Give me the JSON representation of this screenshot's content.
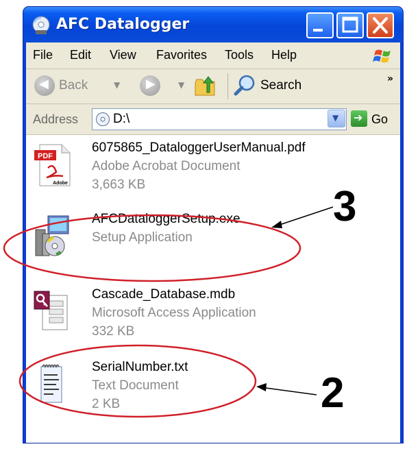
{
  "window": {
    "title": "AFC Datalogger",
    "title_icon": "cd-drive-icon",
    "controls": [
      "minimize",
      "maximize",
      "close"
    ]
  },
  "menubar": {
    "items": [
      "File",
      "Edit",
      "View",
      "Favorites",
      "Tools",
      "Help"
    ]
  },
  "toolbar": {
    "back_label": "Back",
    "search_label": "Search",
    "overflow": "»"
  },
  "address": {
    "label": "Address",
    "value": "D:\\",
    "go_label": "Go"
  },
  "files": [
    {
      "name": "6075865_DataloggerUserManual.pdf",
      "type": "Adobe Acrobat Document",
      "size": "3,663 KB",
      "icon": "pdf-icon"
    },
    {
      "name": "AFCDataloggerSetup.exe",
      "type": "Setup Application",
      "size": "",
      "icon": "setup-icon"
    },
    {
      "name": "Cascade_Database.mdb",
      "type": "Microsoft Access Application",
      "size": "332 KB",
      "icon": "access-icon"
    },
    {
      "name": "SerialNumber.txt",
      "type": "Text Document",
      "size": "2 KB",
      "icon": "text-document-icon"
    }
  ],
  "callouts": {
    "setup": "3",
    "serial": "2",
    "color": "#d0202a"
  },
  "pdf_badge": "PDF",
  "adobe_badge": "Adobe"
}
